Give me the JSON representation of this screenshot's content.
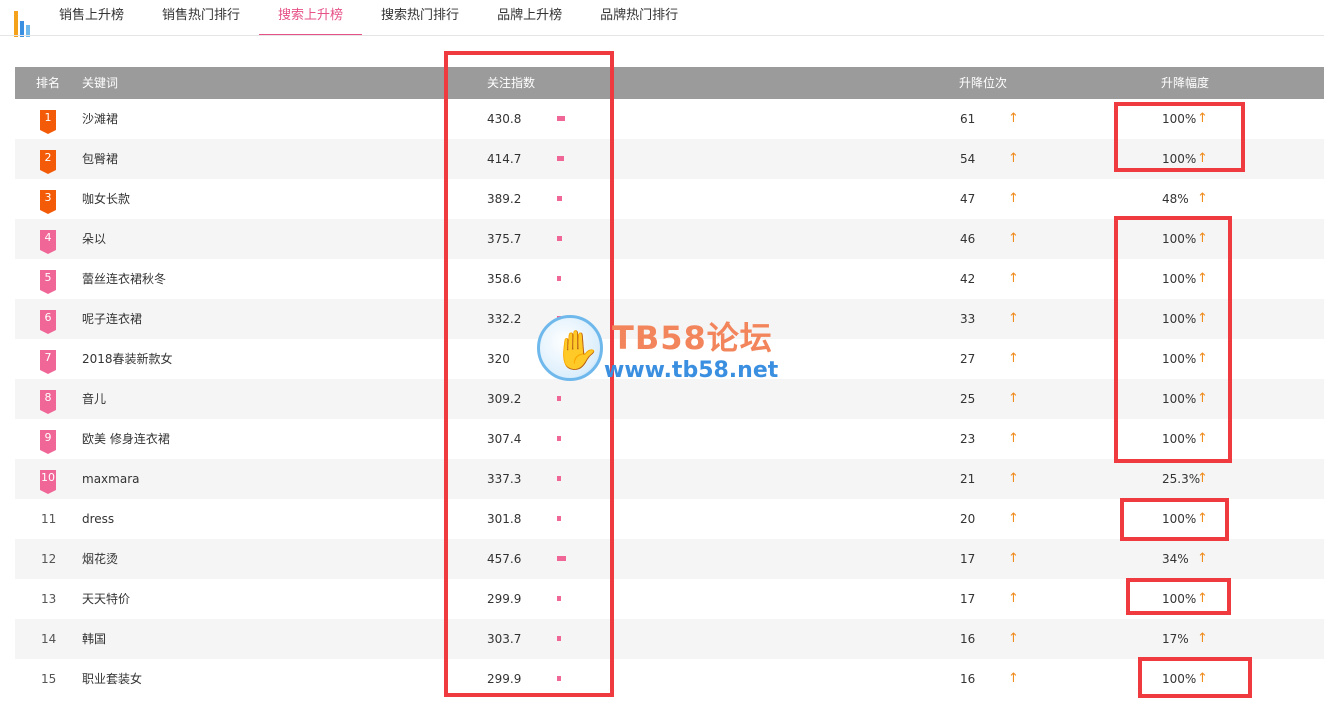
{
  "tabs": [
    {
      "label": "销售上升榜",
      "active": false
    },
    {
      "label": "销售热门排行",
      "active": false
    },
    {
      "label": "搜索上升榜",
      "active": true
    },
    {
      "label": "搜索热门排行",
      "active": false
    },
    {
      "label": "品牌上升榜",
      "active": false
    },
    {
      "label": "品牌热门排行",
      "active": false
    }
  ],
  "table": {
    "headers": {
      "rank": "排名",
      "keyword": "关键词",
      "index": "关注指数",
      "rise": "升降位次",
      "percent": "升降幅度"
    },
    "rows": [
      {
        "rank": "1",
        "keyword": "沙滩裙",
        "index": "430.8",
        "rise": "61",
        "percent": "100%"
      },
      {
        "rank": "2",
        "keyword": "包臀裙",
        "index": "414.7",
        "rise": "54",
        "percent": "100%"
      },
      {
        "rank": "3",
        "keyword": "咖女长款",
        "index": "389.2",
        "rise": "47",
        "percent": "48%"
      },
      {
        "rank": "4",
        "keyword": "朵以",
        "index": "375.7",
        "rise": "46",
        "percent": "100%"
      },
      {
        "rank": "5",
        "keyword": "蕾丝连衣裙秋冬",
        "index": "358.6",
        "rise": "42",
        "percent": "100%"
      },
      {
        "rank": "6",
        "keyword": "呢子连衣裙",
        "index": "332.2",
        "rise": "33",
        "percent": "100%"
      },
      {
        "rank": "7",
        "keyword": "2018春装新款女",
        "index": "320",
        "rise": "27",
        "percent": "100%"
      },
      {
        "rank": "8",
        "keyword": "音儿",
        "index": "309.2",
        "rise": "25",
        "percent": "100%"
      },
      {
        "rank": "9",
        "keyword": "欧美 修身连衣裙",
        "index": "307.4",
        "rise": "23",
        "percent": "100%"
      },
      {
        "rank": "10",
        "keyword": "maxmara",
        "index": "337.3",
        "rise": "21",
        "percent": "25.3%"
      },
      {
        "rank": "11",
        "keyword": "dress",
        "index": "301.8",
        "rise": "20",
        "percent": "100%"
      },
      {
        "rank": "12",
        "keyword": "烟花烫",
        "index": "457.6",
        "rise": "17",
        "percent": "34%"
      },
      {
        "rank": "13",
        "keyword": "天天特价",
        "index": "299.9",
        "rise": "17",
        "percent": "100%"
      },
      {
        "rank": "14",
        "keyword": "韩国",
        "index": "303.7",
        "rise": "16",
        "percent": "17%"
      },
      {
        "rank": "15",
        "keyword": "职业套装女",
        "index": "299.9",
        "rise": "16",
        "percent": "100%"
      }
    ]
  },
  "arrow_glyph": "↑",
  "watermark": {
    "title": "TB58论坛",
    "url": "www.tb58.net"
  },
  "colors": {
    "accent": "#e65187",
    "header_bg": "#9b9b9b",
    "badge_top3": "#f35b08",
    "badge_rest": "#f06797",
    "arrow": "#f08c1e",
    "annotation": "#ef3a40"
  }
}
